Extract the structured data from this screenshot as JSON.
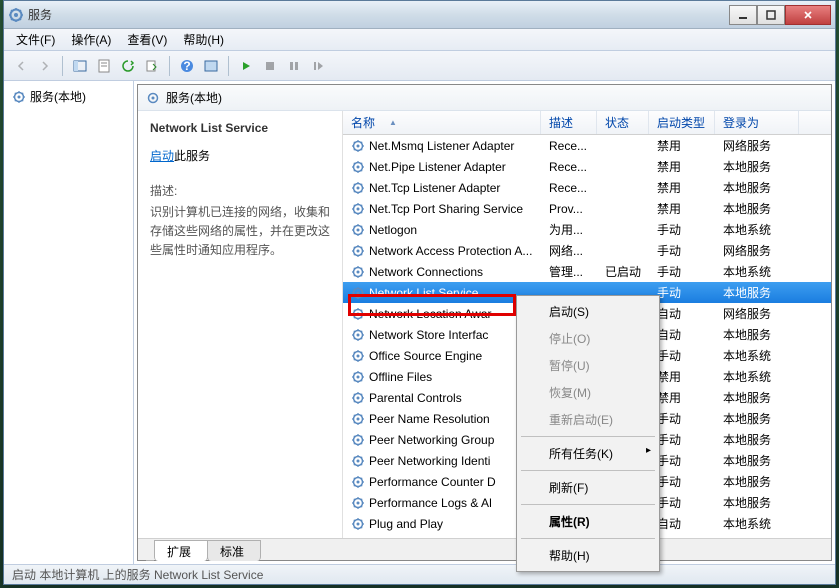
{
  "window": {
    "title": "服务"
  },
  "menubar": [
    "文件(F)",
    "操作(A)",
    "查看(V)",
    "帮助(H)"
  ],
  "tree": {
    "root": "服务(本地)"
  },
  "header_label": "服务(本地)",
  "desc": {
    "title": "Network List Service",
    "action_label": "启动",
    "action_suffix": "此服务",
    "label": "描述:",
    "text": "识别计算机已连接的网络，收集和存储这些网络的属性，并在更改这些属性时通知应用程序。"
  },
  "columns": {
    "name": "名称",
    "desc": "描述",
    "state": "状态",
    "startup": "启动类型",
    "logon": "登录为"
  },
  "rows": [
    {
      "name": "Net.Msmq Listener Adapter",
      "desc": "Rece...",
      "state": "",
      "startup": "禁用",
      "logon": "网络服务"
    },
    {
      "name": "Net.Pipe Listener Adapter",
      "desc": "Rece...",
      "state": "",
      "startup": "禁用",
      "logon": "本地服务"
    },
    {
      "name": "Net.Tcp Listener Adapter",
      "desc": "Rece...",
      "state": "",
      "startup": "禁用",
      "logon": "本地服务"
    },
    {
      "name": "Net.Tcp Port Sharing Service",
      "desc": "Prov...",
      "state": "",
      "startup": "禁用",
      "logon": "本地服务"
    },
    {
      "name": "Netlogon",
      "desc": "为用...",
      "state": "",
      "startup": "手动",
      "logon": "本地系统"
    },
    {
      "name": "Network Access Protection A...",
      "desc": "网络...",
      "state": "",
      "startup": "手动",
      "logon": "网络服务"
    },
    {
      "name": "Network Connections",
      "desc": "管理...",
      "state": "已启动",
      "startup": "手动",
      "logon": "本地系统"
    },
    {
      "name": "Network List Service",
      "desc": "",
      "state": "",
      "startup": "手动",
      "logon": "本地服务",
      "selected": true
    },
    {
      "name": "Network Location Awar",
      "desc": "",
      "state": "",
      "startup": "自动",
      "logon": "网络服务"
    },
    {
      "name": "Network Store Interfac",
      "desc": "",
      "state": "",
      "startup": "自动",
      "logon": "本地服务"
    },
    {
      "name": "Office Source Engine",
      "desc": "",
      "state": "",
      "startup": "手动",
      "logon": "本地系统"
    },
    {
      "name": "Offline Files",
      "desc": "",
      "state": "",
      "startup": "禁用",
      "logon": "本地系统"
    },
    {
      "name": "Parental Controls",
      "desc": "",
      "state": "",
      "startup": "禁用",
      "logon": "本地服务"
    },
    {
      "name": "Peer Name Resolution",
      "desc": "",
      "state": "",
      "startup": "手动",
      "logon": "本地服务"
    },
    {
      "name": "Peer Networking Group",
      "desc": "",
      "state": "",
      "startup": "手动",
      "logon": "本地服务"
    },
    {
      "name": "Peer Networking Identi",
      "desc": "",
      "state": "",
      "startup": "手动",
      "logon": "本地服务"
    },
    {
      "name": "Performance Counter D",
      "desc": "",
      "state": "",
      "startup": "手动",
      "logon": "本地服务"
    },
    {
      "name": "Performance Logs & Al",
      "desc": "",
      "state": "",
      "startup": "手动",
      "logon": "本地服务"
    },
    {
      "name": "Plug and Play",
      "desc": "",
      "state": "",
      "startup": "自动",
      "logon": "本地系统"
    }
  ],
  "context_menu": [
    {
      "label": "启动(S)",
      "enabled": true,
      "highlight": true
    },
    {
      "label": "停止(O)",
      "enabled": false
    },
    {
      "label": "暂停(U)",
      "enabled": false
    },
    {
      "label": "恢复(M)",
      "enabled": false
    },
    {
      "label": "重新启动(E)",
      "enabled": false
    },
    {
      "sep": true
    },
    {
      "label": "所有任务(K)",
      "enabled": true,
      "submenu": true
    },
    {
      "sep": true
    },
    {
      "label": "刷新(F)",
      "enabled": true
    },
    {
      "sep": true
    },
    {
      "label": "属性(R)",
      "enabled": true,
      "bold": true
    },
    {
      "sep": true
    },
    {
      "label": "帮助(H)",
      "enabled": true
    }
  ],
  "tabs": [
    "扩展",
    "标准"
  ],
  "statusbar": "启动 本地计算机 上的服务 Network List Service"
}
